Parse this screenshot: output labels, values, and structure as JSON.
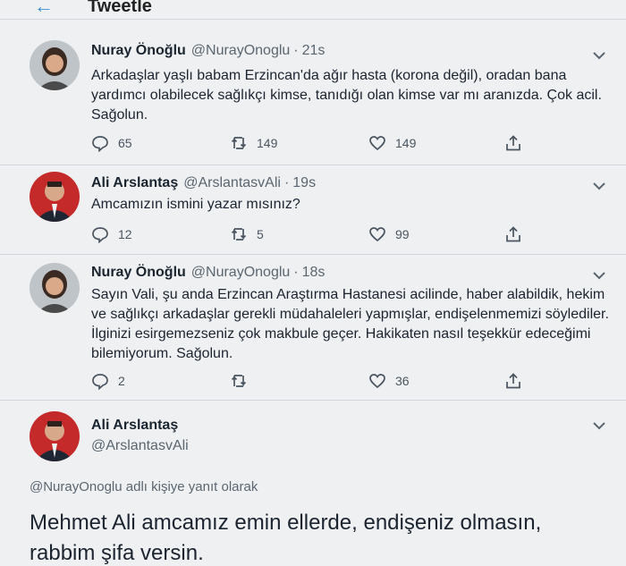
{
  "header": {
    "title": "Tweetle",
    "back_icon": "arrow-left-icon"
  },
  "replies": [
    {
      "name": "Nuray Önoğlu",
      "handle": "@NurayOnoglu",
      "time": "21s",
      "text": "Arkadaşlar yaşlı babam Erzincan'da ağır hasta (korona değil), oradan bana yardımcı olabilecek sağlıkçı kimse, tanıdığı olan kimse var mı aranızda. Çok acil. Sağolun.",
      "replies_count": "65",
      "retweets_count": "149",
      "likes_count": "149"
    },
    {
      "name": "Ali Arslantaş",
      "handle": "@ArslantasvAli",
      "time": "19s",
      "text": "Amcamızın ismini yazar mısınız?",
      "replies_count": "12",
      "retweets_count": "5",
      "likes_count": "99"
    },
    {
      "name": "Nuray Önoğlu",
      "handle": "@NurayOnoglu",
      "time": "18s",
      "text": "Sayın Vali, şu anda Erzincan Araştırma Hastanesi acilinde, haber alabildik, hekim ve sağlıkçı arkadaşlar gerekli müdahaleleri yapmışlar, endişelenmemizi söylediler. İlginizi esirgemezseniz çok makbule geçer. Hakikaten nasıl teşekkür edeceğimi bilemiyorum. Sağolun.",
      "replies_count": "2",
      "retweets_count": "",
      "likes_count": "36"
    }
  ],
  "main_tweet": {
    "name": "Ali Arslantaş",
    "handle": "@ArslantasvAli",
    "reply_to": "@NurayOnoglu adlı kişiye yanıt olarak",
    "text": "Mehmet Ali amcamız emin ellerde, endişeniz olmasın, rabbim şifa versin."
  },
  "colors": {
    "accent": "#3b8fd8",
    "text": "#1c2430",
    "muted": "#5b6670",
    "background": "#eef0f2"
  }
}
